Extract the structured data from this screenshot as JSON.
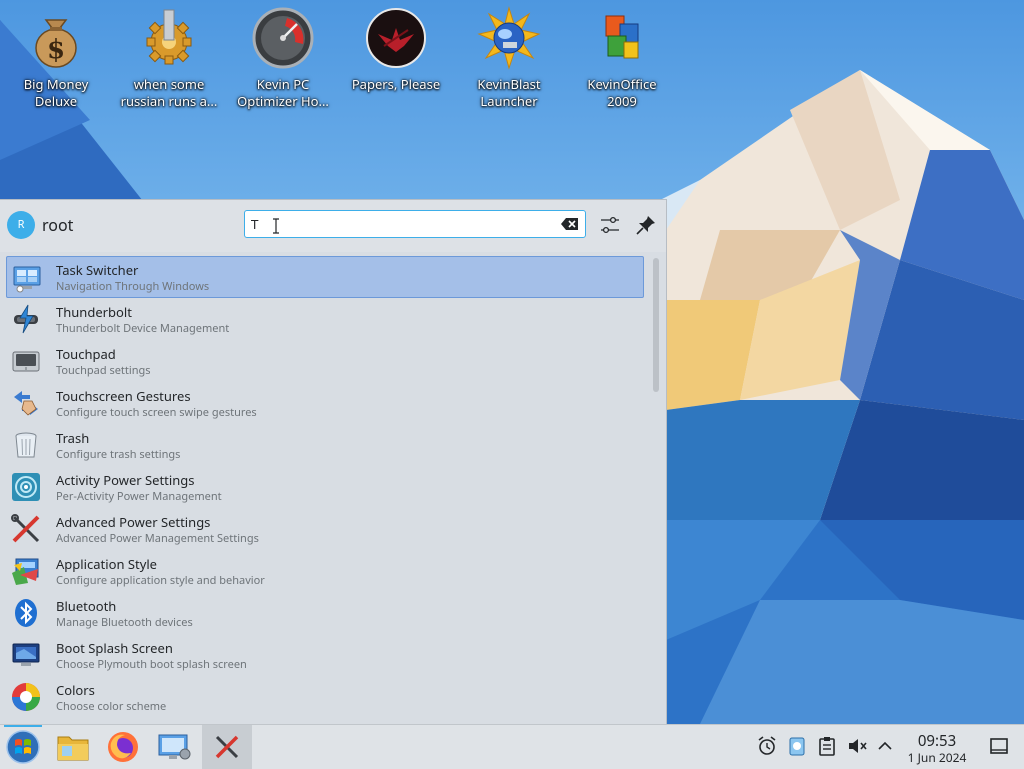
{
  "desktop": {
    "icons": [
      {
        "label_line1": "Big Money",
        "label_line2": "Deluxe",
        "icon": "money-bag-icon"
      },
      {
        "label_line1": "when some",
        "label_line2": "russian runs a...",
        "icon": "gear-icon"
      },
      {
        "label_line1": "Kevin PC",
        "label_line2": "Optimizer Ho...",
        "icon": "speedometer-icon"
      },
      {
        "label_line1": "Papers, Please",
        "label_line2": "",
        "icon": "eagle-emblem-icon"
      },
      {
        "label_line1": "KevinBlast",
        "label_line2": "Launcher",
        "icon": "globe-sun-icon"
      },
      {
        "label_line1": "KevinOffice",
        "label_line2": "2009",
        "icon": "office-logo-icon"
      }
    ]
  },
  "launcher": {
    "user": {
      "initial": "R",
      "name": "root"
    },
    "search": {
      "value": "T",
      "placeholder": ""
    },
    "results": [
      {
        "title": "Task Switcher",
        "subtitle": "Navigation Through Windows",
        "icon": "task-switcher-icon"
      },
      {
        "title": "Thunderbolt",
        "subtitle": "Thunderbolt Device Management",
        "icon": "thunderbolt-icon"
      },
      {
        "title": "Touchpad",
        "subtitle": "Touchpad settings",
        "icon": "touchpad-icon"
      },
      {
        "title": "Touchscreen Gestures",
        "subtitle": "Configure touch screen swipe gestures",
        "icon": "touchscreen-icon"
      },
      {
        "title": "Trash",
        "subtitle": "Configure trash settings",
        "icon": "trash-icon"
      },
      {
        "title": "Activity Power Settings",
        "subtitle": "Per-Activity Power Management",
        "icon": "activity-power-icon"
      },
      {
        "title": "Advanced Power Settings",
        "subtitle": "Advanced Power Management Settings",
        "icon": "tools-icon"
      },
      {
        "title": "Application Style",
        "subtitle": "Configure application style and behavior",
        "icon": "app-style-icon"
      },
      {
        "title": "Bluetooth",
        "subtitle": "Manage Bluetooth devices",
        "icon": "bluetooth-icon"
      },
      {
        "title": "Boot Splash Screen",
        "subtitle": "Choose Plymouth boot splash screen",
        "icon": "boot-splash-icon"
      },
      {
        "title": "Colors",
        "subtitle": "Choose color scheme",
        "icon": "colors-icon"
      }
    ]
  },
  "taskbar": {
    "clock": {
      "time": "09:53",
      "date": "1 Jun 2024"
    }
  },
  "colors": {
    "accent": "#3daee9",
    "selection": "#a4bfe8"
  }
}
